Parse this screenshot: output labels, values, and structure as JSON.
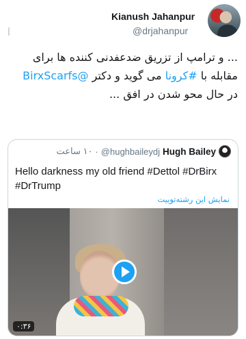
{
  "tweet": {
    "author": {
      "display_name": "Kianush Jahanpur",
      "handle": "@drjahanpur"
    },
    "text_parts": {
      "p1": "... و ترامپ از تزریق ضدعفدنی کننده ها برای مقابله با ",
      "hashtag": "#کرونا",
      "p2": " می گوید و دکتر ",
      "mention": "@BirxScarfs",
      "p3": " در حال محو شدن در افق ..."
    }
  },
  "quoted_tweet": {
    "display_name": "Hugh Bailey",
    "handle": "@hughbaileydj",
    "time": "۱۰ ساعت",
    "separator": "·",
    "text": "Hello darkness my old friend #Dettol #DrBirx #DrTrump",
    "show_thread": "نمایش این رشته‌توییت",
    "video": {
      "duration": "۰:۳۶",
      "play_icon": "play-icon"
    }
  },
  "colors": {
    "link": "#1da1f2",
    "secondary_text": "#657786",
    "border": "#ccd6dd"
  }
}
